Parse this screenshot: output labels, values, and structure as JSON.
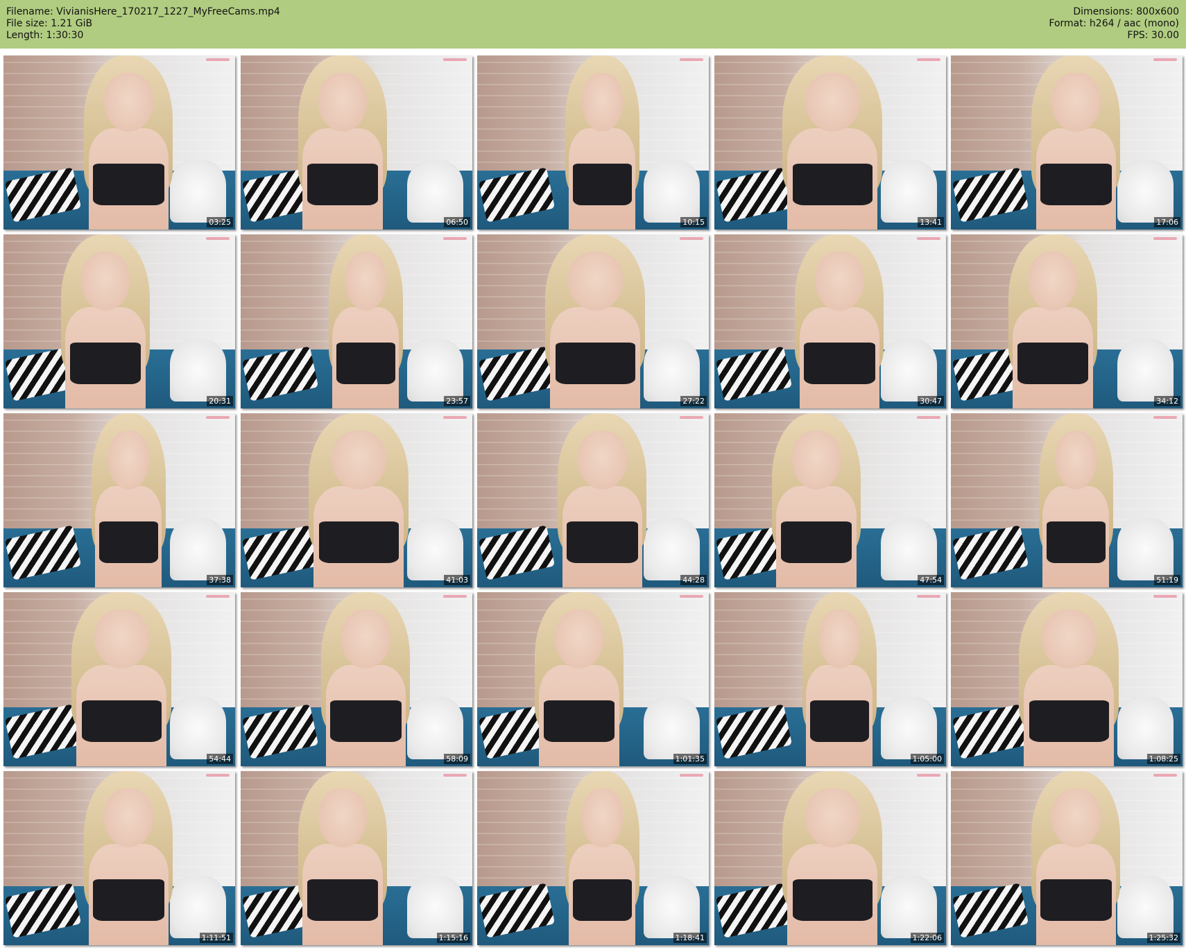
{
  "header": {
    "filename": "Filename: VivianisHere_170217_1227_MyFreeCams.mp4",
    "filesize": "File size: 1.21 GiB",
    "length": "Length: 1:30:30",
    "dimensions": "Dimensions: 800x600",
    "format": "Format: h264 / aac (mono)",
    "fps": "FPS: 30.00"
  },
  "colors": {
    "header_bg": "#b0cc80",
    "timestamp_text": "#ffffff"
  },
  "thumbnails": [
    {
      "time": "03:25"
    },
    {
      "time": "06:50"
    },
    {
      "time": "10:15"
    },
    {
      "time": "13:41"
    },
    {
      "time": "17:06"
    },
    {
      "time": "20:31"
    },
    {
      "time": "23:57"
    },
    {
      "time": "27:22"
    },
    {
      "time": "30:47"
    },
    {
      "time": "34:12"
    },
    {
      "time": "37:38"
    },
    {
      "time": "41:03"
    },
    {
      "time": "44:28"
    },
    {
      "time": "47:54"
    },
    {
      "time": "51:19"
    },
    {
      "time": "54:44"
    },
    {
      "time": "58:09"
    },
    {
      "time": "1:01:35"
    },
    {
      "time": "1:05:00"
    },
    {
      "time": "1:08:25"
    },
    {
      "time": "1:11:51"
    },
    {
      "time": "1:15:16"
    },
    {
      "time": "1:18:41"
    },
    {
      "time": "1:22:06"
    },
    {
      "time": "1:25:32"
    }
  ]
}
